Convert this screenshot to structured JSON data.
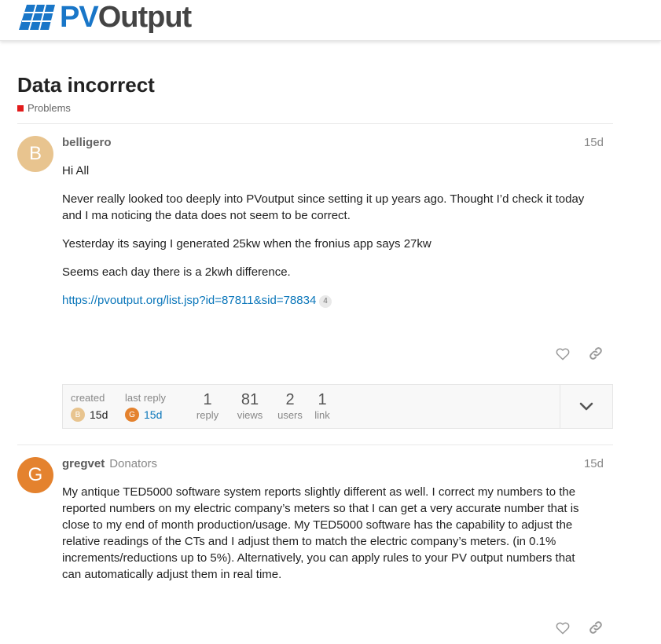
{
  "brand": {
    "pv": "PV",
    "out": "Output"
  },
  "topic": {
    "title": "Data incorrect",
    "category": "Problems"
  },
  "posts": [
    {
      "username": "belligero",
      "avatar_letter": "B",
      "avatar_color": "#e8c48f",
      "date": "15d",
      "paragraphs": [
        "Hi All",
        "Never really looked too deeply into PVoutput since setting it up years ago. Thought I’d check it today and I ma noticing the data does not seem to be correct.",
        "Yesterday its saying I generated 25kw when the fronius app says 27kw",
        "Seems each day there is a 2kwh difference."
      ],
      "link_text": "https://pvoutput.org/list.jsp?id=87811&sid=78834",
      "link_clicks": "4"
    },
    {
      "username": "gregvet",
      "flair": "Donators",
      "avatar_letter": "G",
      "avatar_color": "#e4822e",
      "date": "15d",
      "body": "My antique TED5000 software system reports slightly different as well. I correct my numbers to the reported numbers on my electric company’s meters so that I can get a very accurate number that is close to my end of month production/usage. My TED5000 software has the capability to adjust the relative readings of the CTs and I adjust them to match the electric company’s meters. (in 0.1% increments/reductions up to 5%). Alternatively, you can apply rules to your PV output numbers that can automatically adjust them in real time."
    }
  ],
  "summary": {
    "created_label": "created",
    "created_letter": "B",
    "created_date": "15d",
    "last_reply_label": "last reply",
    "last_reply_letter": "G",
    "last_reply_date": "15d",
    "replies": "1",
    "replies_label": "reply",
    "views": "81",
    "views_label": "views",
    "users": "2",
    "users_label": "users",
    "links": "1",
    "links_label": "link"
  },
  "icons": {
    "like": "heart-icon",
    "share": "link-icon",
    "expand": "chevron-down-icon"
  }
}
